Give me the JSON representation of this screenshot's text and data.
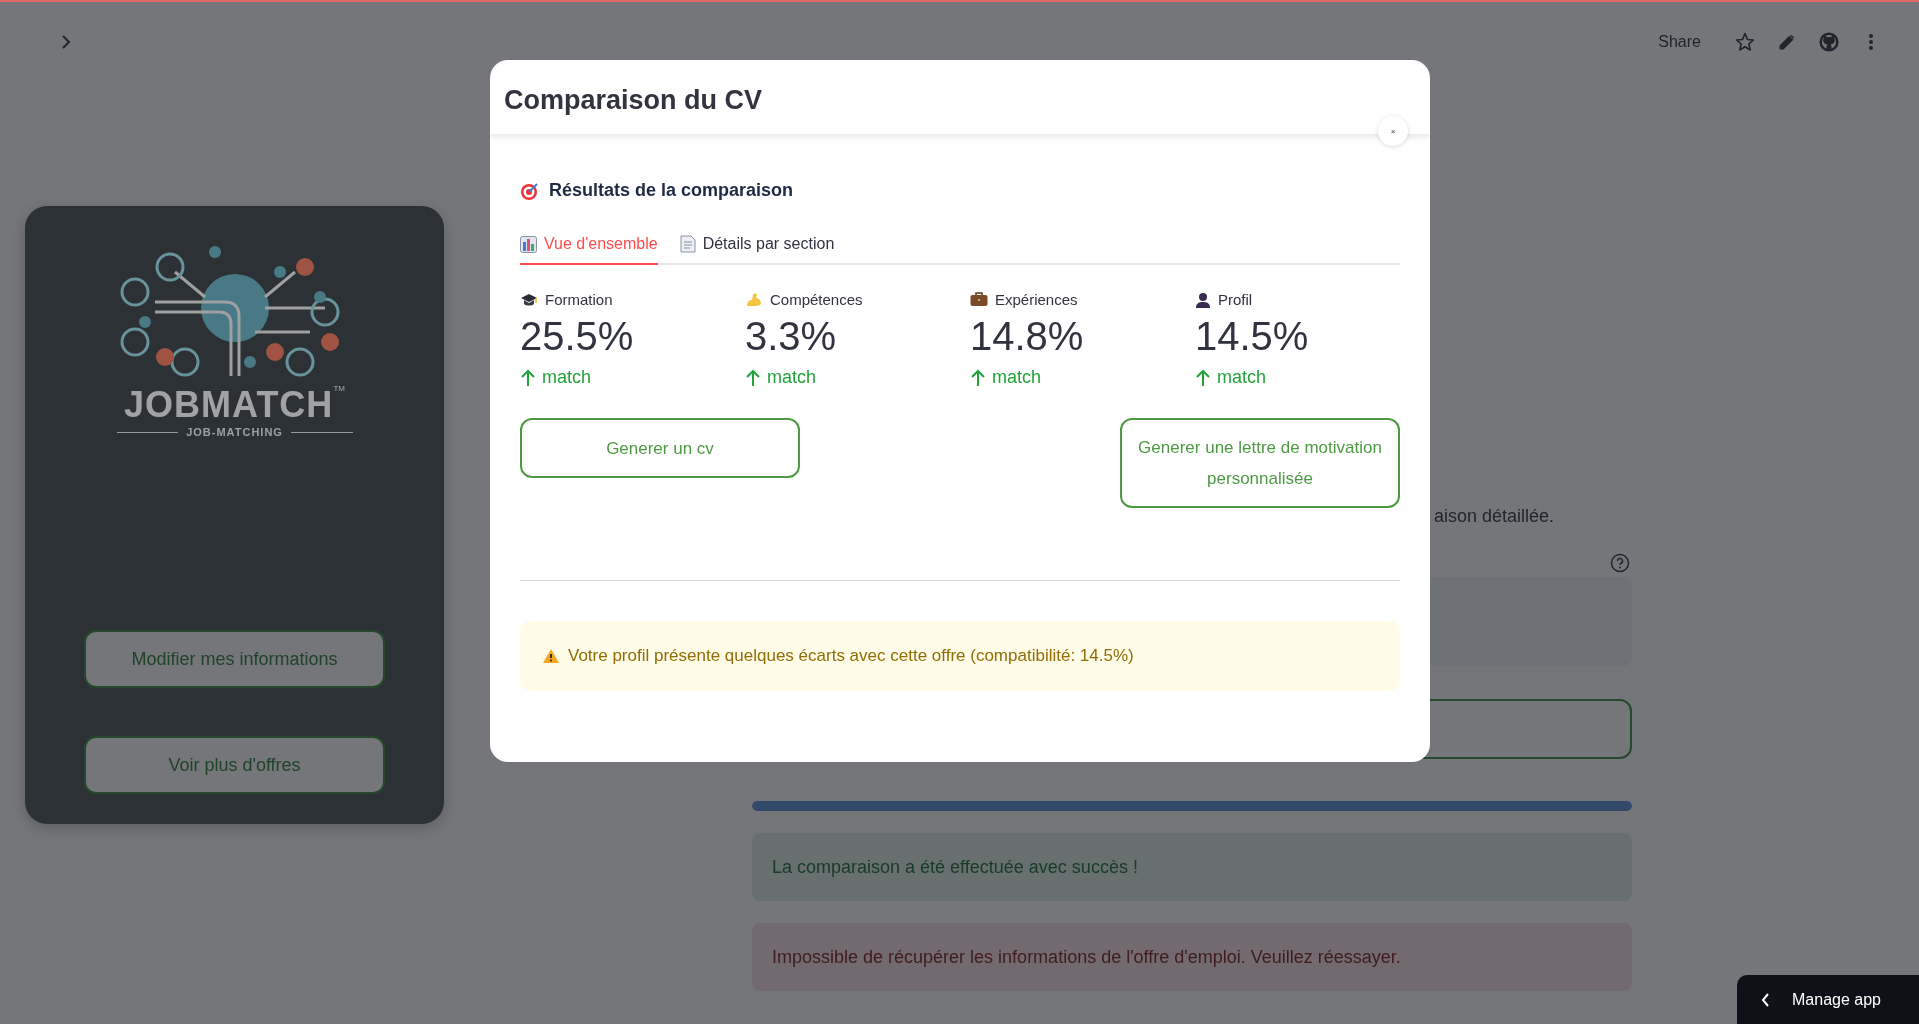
{
  "toolbar": {
    "share": "Share"
  },
  "sidebar_card": {
    "logo": {
      "name": "JOBMATCH",
      "trademark": "TM",
      "tagline": "JOB-MATCHING"
    },
    "buttons": [
      "Modifier mes informations",
      "Voir plus d'offres"
    ]
  },
  "main": {
    "description_fragment": "aison détaillée.",
    "progress": {
      "level": 1
    },
    "alerts": [
      {
        "kind": "success",
        "text": "La comparaison a été effectuée avec succès !"
      },
      {
        "kind": "error",
        "text": "Impossible de récupérer les informations de l'offre d'emploi. Veuillez réessayer."
      }
    ]
  },
  "dialog": {
    "title": "Comparaison du CV",
    "close": "×",
    "heading": "Résultats de la comparaison",
    "tabs": [
      {
        "label": "Vue d'ensemble",
        "selected": true
      },
      {
        "label": "Détails par section",
        "selected": false
      }
    ],
    "metrics": [
      {
        "label": "Formation",
        "value": "25.5%",
        "delta": "match"
      },
      {
        "label": "Compétences",
        "value": "3.3%",
        "delta": "match"
      },
      {
        "label": "Expériences",
        "value": "14.8%",
        "delta": "match"
      },
      {
        "label": "Profil",
        "value": "14.5%",
        "delta": "match"
      }
    ],
    "buttons": [
      "Generer un cv",
      "Generer une lettre de motivation personnalisée"
    ],
    "warning": {
      "text": "Votre profil présente quelques écarts avec cette offre (compatibilité: 14.5%)"
    }
  },
  "manage_app": "Manage app"
}
